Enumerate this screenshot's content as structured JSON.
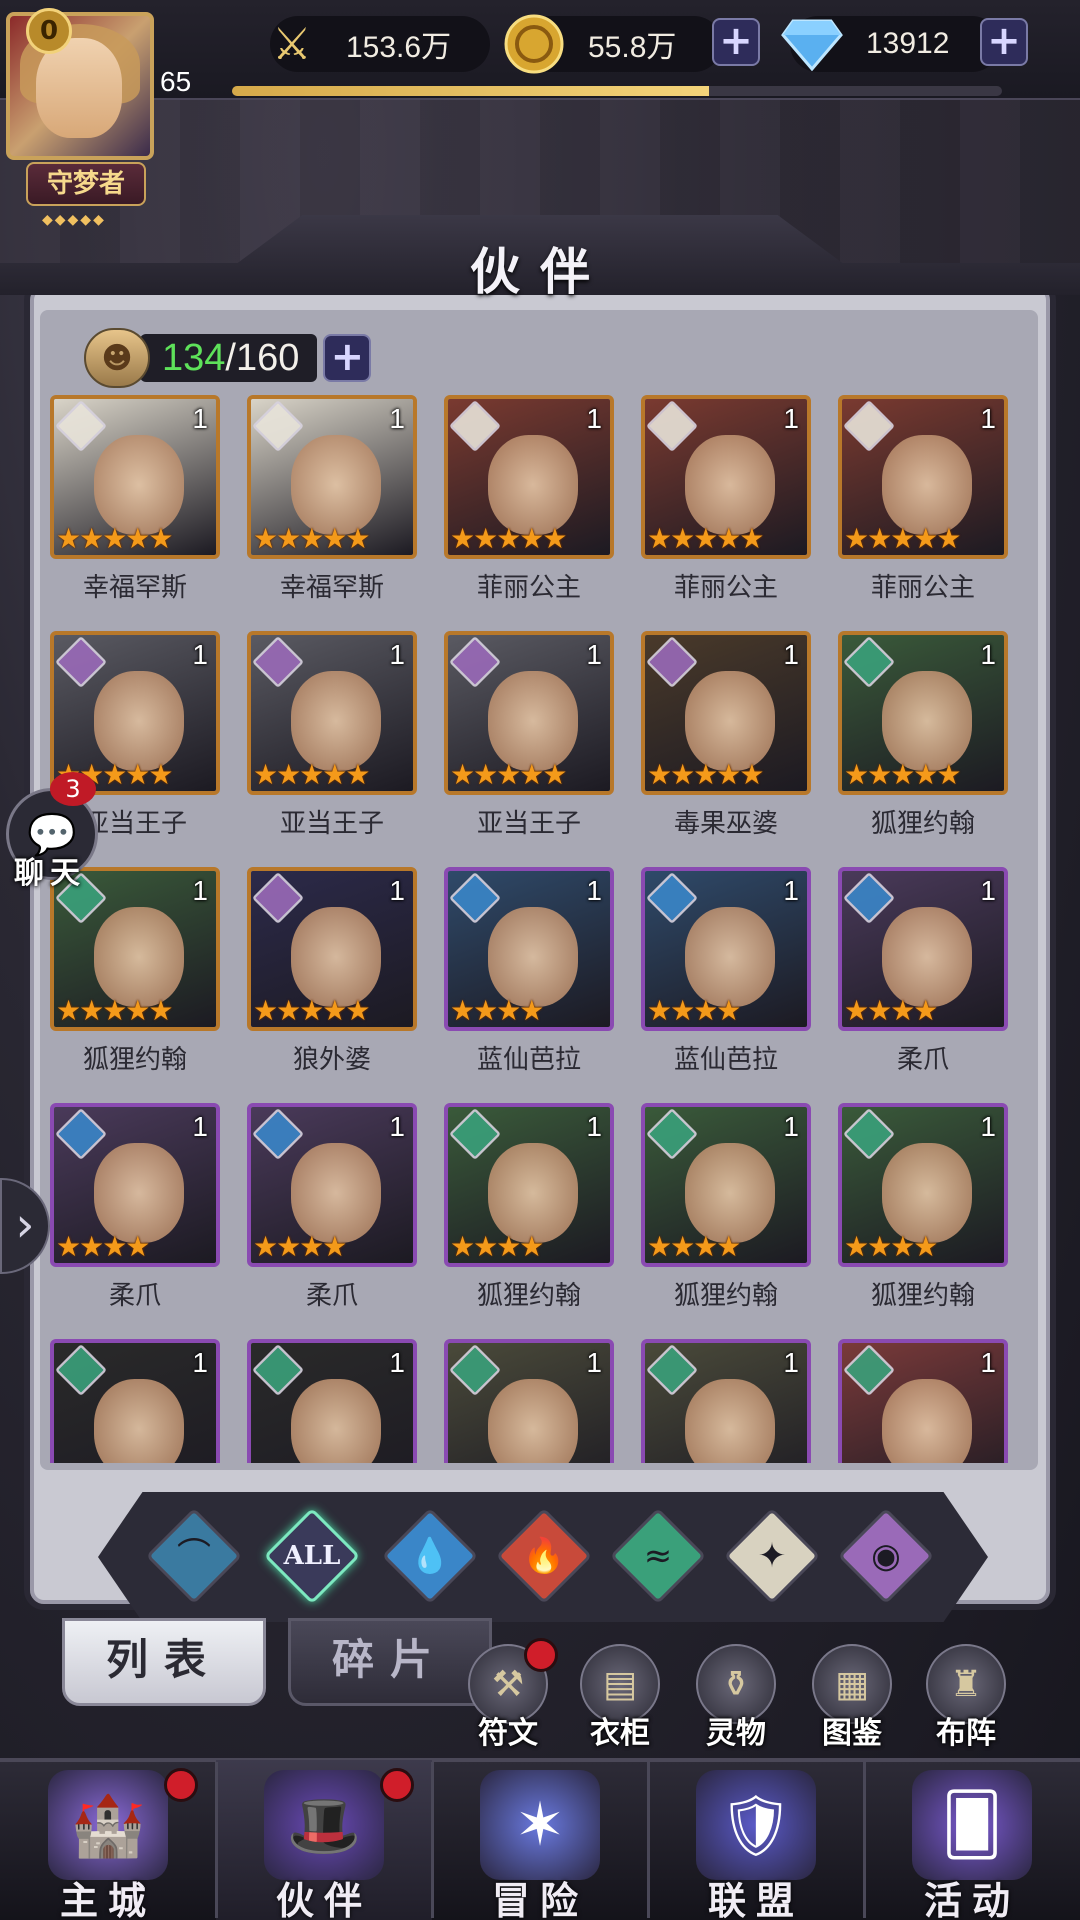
{
  "player": {
    "vip": "0",
    "level": "65",
    "xp_fraction": 0.62,
    "rank_title": "守梦者"
  },
  "resources": {
    "power": {
      "icon": "sword-wings-icon",
      "value": "153.6万"
    },
    "gold": {
      "icon": "gold-coin-icon",
      "value": "55.8万"
    },
    "diamond": {
      "icon": "diamond-icon",
      "value": "13912"
    },
    "plus": "+"
  },
  "panel": {
    "title": "伙伴",
    "count_current": "134",
    "count_max": "/160"
  },
  "chat": {
    "unread": "3",
    "label": "聊天"
  },
  "partners": [
    {
      "name": "幸福罕斯",
      "level": "1",
      "stars": 5,
      "element": "star",
      "frame": "gold",
      "art": "#d9d4c8"
    },
    {
      "name": "幸福罕斯",
      "level": "1",
      "stars": 5,
      "element": "star",
      "frame": "gold",
      "art": "#d9d4c8"
    },
    {
      "name": "菲丽公主",
      "level": "1",
      "stars": 5,
      "element": "star",
      "frame": "gold",
      "art": "#7a3a30"
    },
    {
      "name": "菲丽公主",
      "level": "1",
      "stars": 5,
      "element": "star",
      "frame": "gold",
      "art": "#7a3a30"
    },
    {
      "name": "菲丽公主",
      "level": "1",
      "stars": 5,
      "element": "star",
      "frame": "gold",
      "art": "#7a3a30"
    },
    {
      "name": "亚当王子",
      "level": "1",
      "stars": 5,
      "element": "dark",
      "frame": "gold",
      "art": "#5a5a62"
    },
    {
      "name": "亚当王子",
      "level": "1",
      "stars": 5,
      "element": "dark",
      "frame": "gold",
      "art": "#5a5a62"
    },
    {
      "name": "亚当王子",
      "level": "1",
      "stars": 5,
      "element": "dark",
      "frame": "gold",
      "art": "#5a5a62"
    },
    {
      "name": "毒果巫婆",
      "level": "1",
      "stars": 5,
      "element": "dark",
      "frame": "gold",
      "art": "#4a3a2a"
    },
    {
      "name": "狐狸约翰",
      "level": "1",
      "stars": 5,
      "element": "wind",
      "frame": "gold",
      "art": "#3a5a3a"
    },
    {
      "name": "狐狸约翰",
      "level": "1",
      "stars": 5,
      "element": "wind",
      "frame": "gold",
      "art": "#3a5a3a"
    },
    {
      "name": "狼外婆",
      "level": "1",
      "stars": 5,
      "element": "dark",
      "frame": "gold",
      "art": "#2c2a4a"
    },
    {
      "name": "蓝仙芭拉",
      "level": "1",
      "stars": 4,
      "element": "water",
      "frame": "purple",
      "art": "#2f4a6a"
    },
    {
      "name": "蓝仙芭拉",
      "level": "1",
      "stars": 4,
      "element": "water",
      "frame": "purple",
      "art": "#2f4a6a"
    },
    {
      "name": "柔爪",
      "level": "1",
      "stars": 4,
      "element": "water",
      "frame": "purple",
      "art": "#4a3a5a"
    },
    {
      "name": "柔爪",
      "level": "1",
      "stars": 4,
      "element": "water",
      "frame": "purple",
      "art": "#4a3a5a"
    },
    {
      "name": "柔爪",
      "level": "1",
      "stars": 4,
      "element": "water",
      "frame": "purple",
      "art": "#4a3a5a"
    },
    {
      "name": "狐狸约翰",
      "level": "1",
      "stars": 4,
      "element": "wind",
      "frame": "purple",
      "art": "#3a5a3a"
    },
    {
      "name": "狐狸约翰",
      "level": "1",
      "stars": 4,
      "element": "wind",
      "frame": "purple",
      "art": "#3a5a3a"
    },
    {
      "name": "狐狸约翰",
      "level": "1",
      "stars": 4,
      "element": "wind",
      "frame": "purple",
      "art": "#3a5a3a"
    },
    {
      "name": "",
      "level": "1",
      "stars": 0,
      "element": "wind",
      "frame": "purple",
      "art": "#2a2a2a"
    },
    {
      "name": "",
      "level": "1",
      "stars": 0,
      "element": "wind",
      "frame": "purple",
      "art": "#2a2a2a"
    },
    {
      "name": "",
      "level": "1",
      "stars": 0,
      "element": "wind",
      "frame": "purple",
      "art": "#4a4a3a"
    },
    {
      "name": "",
      "level": "1",
      "stars": 0,
      "element": "wind",
      "frame": "purple",
      "art": "#4a4a3a"
    },
    {
      "name": "",
      "level": "1",
      "stars": 0,
      "element": "wind",
      "frame": "purple",
      "art": "#7a3a3a"
    }
  ],
  "filters": [
    {
      "id": "filter-tab-1",
      "icon": "arch-icon",
      "label": "",
      "color": "#3a7aa0"
    },
    {
      "id": "filter-tab-all",
      "icon": "all-icon",
      "label": "ALL",
      "color": "#5a5a8a",
      "active": true
    },
    {
      "id": "filter-tab-water",
      "icon": "water-drop-icon",
      "label": "",
      "color": "#3a86c8"
    },
    {
      "id": "filter-tab-fire",
      "icon": "fire-icon",
      "label": "",
      "color": "#c84a3a"
    },
    {
      "id": "filter-tab-wind",
      "icon": "wind-icon",
      "label": "",
      "color": "#3aa07a"
    },
    {
      "id": "filter-tab-light",
      "icon": "star-icon",
      "label": "",
      "color": "#d8d2c0"
    },
    {
      "id": "filter-tab-dark",
      "icon": "eye-icon",
      "label": "",
      "color": "#9a6ab8"
    }
  ],
  "tabs": {
    "list": "列表",
    "fragments": "碎片"
  },
  "tools": [
    {
      "label": "符文",
      "icon": "rune-icon",
      "alert": true
    },
    {
      "label": "衣柜",
      "icon": "wardrobe-icon",
      "alert": false
    },
    {
      "label": "灵物",
      "icon": "lamp-icon",
      "alert": false
    },
    {
      "label": "图鉴",
      "icon": "codex-icon",
      "alert": false
    },
    {
      "label": "布阵",
      "icon": "formation-icon",
      "alert": false
    }
  ],
  "nav": [
    {
      "label": "主城",
      "icon": "castle-icon",
      "alert": true,
      "active": false
    },
    {
      "label": "伙伴",
      "icon": "wizard-hat-icon",
      "alert": true,
      "active": true
    },
    {
      "label": "冒险",
      "icon": "compass-icon",
      "alert": false,
      "active": false
    },
    {
      "label": "联盟",
      "icon": "shield-icon",
      "alert": false,
      "active": false
    },
    {
      "label": "活动",
      "icon": "cards-icon",
      "alert": false,
      "active": false
    }
  ],
  "colors": {
    "count_current": "#5ee25a",
    "gold_frame": "#b8782a",
    "purple_frame": "#8a4ab2",
    "star": "#f49a1a",
    "alert_red": "#d01e2a"
  }
}
